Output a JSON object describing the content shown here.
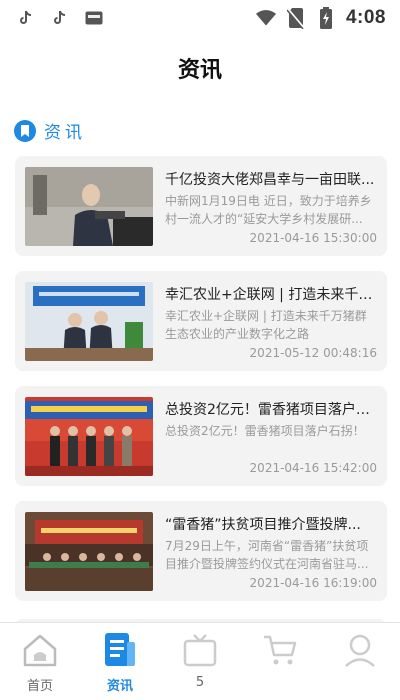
{
  "status_bar": {
    "time": "4:08"
  },
  "header": {
    "title": "资讯"
  },
  "section": {
    "label": "资讯"
  },
  "news": [
    {
      "title": "千亿投资大佬郑昌幸与一亩田联...",
      "summary": "中新网1月19日电 近日，致力于培养乡村一流人才的“延安大学乡村发展研...",
      "time": "2021-04-16 15:30:00"
    },
    {
      "title": "幸汇农业+企联网 | 打造未来千万...",
      "summary": "幸汇农业+企联网 | 打造未来千万猪群生态农业的产业数字化之路",
      "time": "2021-05-12 00:48:16"
    },
    {
      "title": "总投资2亿元！雷香猪项目落户石...",
      "summary": "总投资2亿元！雷香猪项目落户石拐！",
      "time": "2021-04-16 15:42:00"
    },
    {
      "title": "“雷香猪”扶贫项目推介暨投牌...",
      "summary": "7月29日上午，河南省“雷香猪”扶贫项目推介暨投牌签约仪式在河南省驻马...",
      "time": "2021-04-16 16:19:00"
    }
  ],
  "bottom_nav": [
    {
      "label": "首页",
      "icon": "home-icon",
      "active": false
    },
    {
      "label": "资讯",
      "icon": "news-icon",
      "active": true
    },
    {
      "label": "5",
      "icon": "tv-icon",
      "active": false
    },
    {
      "label": "",
      "icon": "cart-icon",
      "active": false
    },
    {
      "label": "",
      "icon": "profile-icon",
      "active": false
    }
  ],
  "colors": {
    "accent": "#1e88e5",
    "card_bg": "#f3f3f3",
    "muted_text": "#9a9a9a"
  }
}
